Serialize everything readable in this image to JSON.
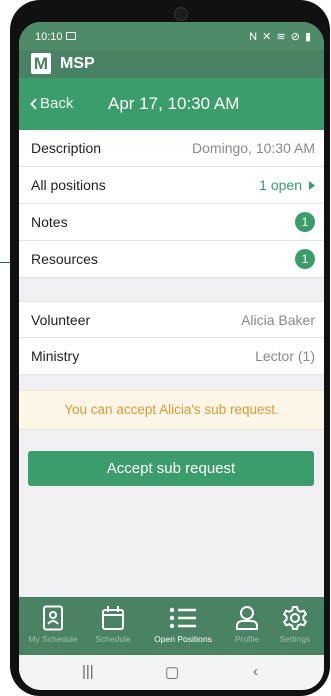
{
  "status_bar": {
    "time": "10:10",
    "right_icons": "N ✕ ≋ ⊘ ▮"
  },
  "app": {
    "logo_letter": "M",
    "name": "MSP"
  },
  "nav": {
    "back_label": "Back",
    "title": "Apr 17, 10:30 AM"
  },
  "details": [
    {
      "label": "Description",
      "value": "Domingo, 10:30 AM"
    },
    {
      "label": "All positions",
      "value": "1 open"
    },
    {
      "label": "Notes",
      "badge": "1"
    },
    {
      "label": "Resources",
      "badge": "1"
    }
  ],
  "assignment": [
    {
      "label": "Volunteer",
      "value": "Alicia Baker"
    },
    {
      "label": "Ministry",
      "value": "Lector (1)"
    }
  ],
  "banner": {
    "text": "You can accept Alicia's sub request."
  },
  "actions": {
    "accept_label": "Accept sub request"
  },
  "tabs": [
    {
      "label": "My Schedule",
      "icon": "contact-card-icon",
      "active": false
    },
    {
      "label": "Schedule",
      "icon": "calendar-icon",
      "active": false
    },
    {
      "label": "Open Positions",
      "icon": "list-icon",
      "active": true
    },
    {
      "label": "Profile",
      "icon": "person-icon",
      "active": false
    },
    {
      "label": "Settings",
      "icon": "gear-icon",
      "active": false
    }
  ],
  "colors": {
    "brand_green": "#3b9c6c",
    "app_bar": "#4a8264",
    "banner_text": "#d79a3a"
  }
}
